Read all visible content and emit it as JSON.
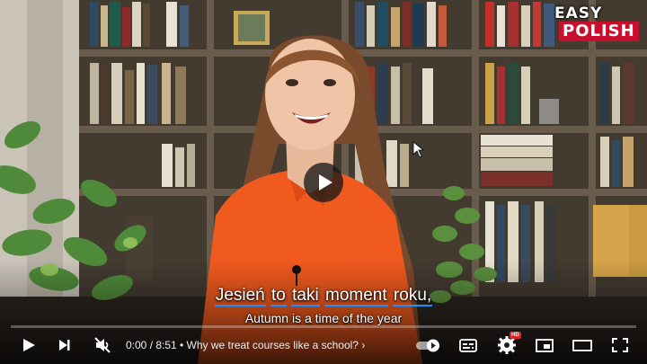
{
  "logo": {
    "line1": "EASY",
    "line2": "POLISH"
  },
  "captions": {
    "polish": [
      "Jesień",
      "to",
      "taki",
      "moment",
      "roku,"
    ],
    "english": "Autumn is a time of the year"
  },
  "controls": {
    "time": "0:00 / 8:51",
    "chapter_separator": "•",
    "chapter": "Why we treat courses like a school?",
    "chapter_chevron": "›",
    "hd_badge": "HD",
    "progress": 0,
    "progress_color": "#ff0000"
  },
  "icons": [
    "play-icon",
    "next-icon",
    "mute-icon",
    "autoplay-toggle",
    "subtitles-icon",
    "settings-icon",
    "miniplayer-icon",
    "theater-icon",
    "fullscreen-icon"
  ]
}
